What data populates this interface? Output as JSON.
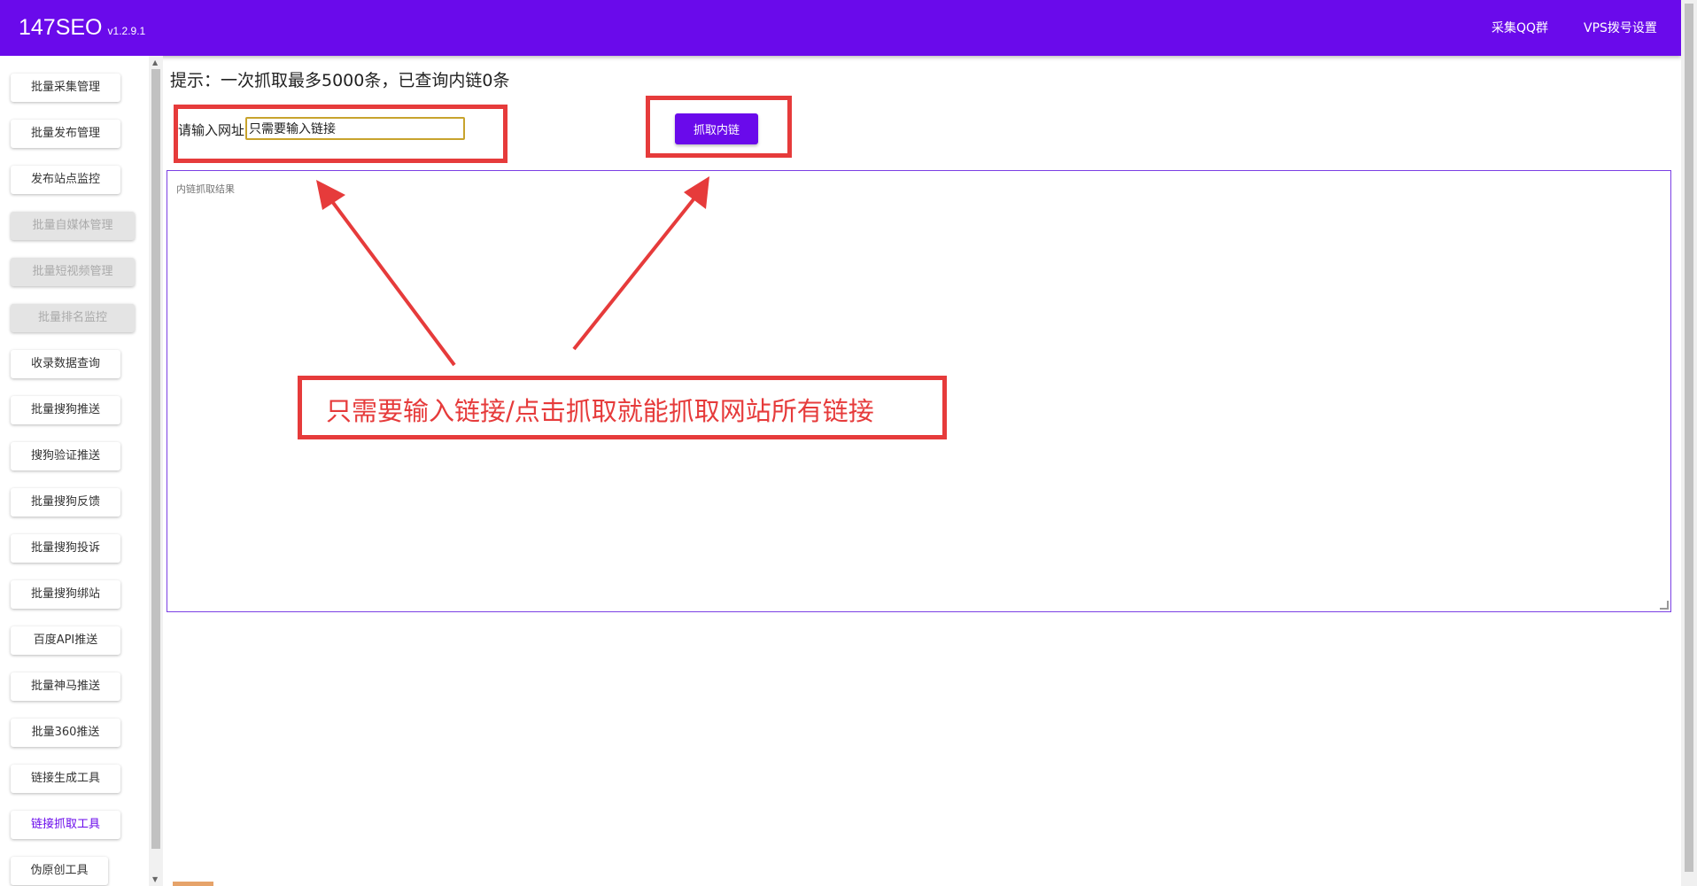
{
  "app": {
    "title": "147SEO",
    "version": "v1.2.9.1"
  },
  "topbar": {
    "qq_group": "采集QQ群",
    "vps_settings": "VPS拨号设置"
  },
  "sidebar": {
    "items": [
      {
        "label": "批量采集管理",
        "state": "normal"
      },
      {
        "label": "批量发布管理",
        "state": "normal"
      },
      {
        "label": "发布站点监控",
        "state": "normal"
      },
      {
        "label": "批量自媒体管理",
        "state": "disabled"
      },
      {
        "label": "批量短视频管理",
        "state": "disabled"
      },
      {
        "label": "批量排名监控",
        "state": "disabled"
      },
      {
        "label": "收录数据查询",
        "state": "normal"
      },
      {
        "label": "批量搜狗推送",
        "state": "normal"
      },
      {
        "label": "搜狗验证推送",
        "state": "normal"
      },
      {
        "label": "批量搜狗反馈",
        "state": "normal"
      },
      {
        "label": "批量搜狗投诉",
        "state": "normal"
      },
      {
        "label": "批量搜狗绑站",
        "state": "normal"
      },
      {
        "label": "百度API推送",
        "state": "normal"
      },
      {
        "label": "批量神马推送",
        "state": "normal"
      },
      {
        "label": "批量360推送",
        "state": "normal"
      },
      {
        "label": "链接生成工具",
        "state": "normal"
      },
      {
        "label": "链接抓取工具",
        "state": "active"
      },
      {
        "label": "伪原创工具",
        "state": "normal"
      }
    ]
  },
  "main": {
    "tip": "提示：一次抓取最多5000条，已查询内链0条",
    "url_label": "请输入网址",
    "url_value": "只需要输入链接",
    "fetch_button": "抓取内链",
    "result_placeholder": "内链抓取结果"
  },
  "annotation": {
    "text": "只需要输入链接/点击抓取就能抓取网站所有链接"
  },
  "colors": {
    "accent": "#6a0aeb",
    "annotation_red": "#e63b3b",
    "input_border": "#c8a32d"
  }
}
